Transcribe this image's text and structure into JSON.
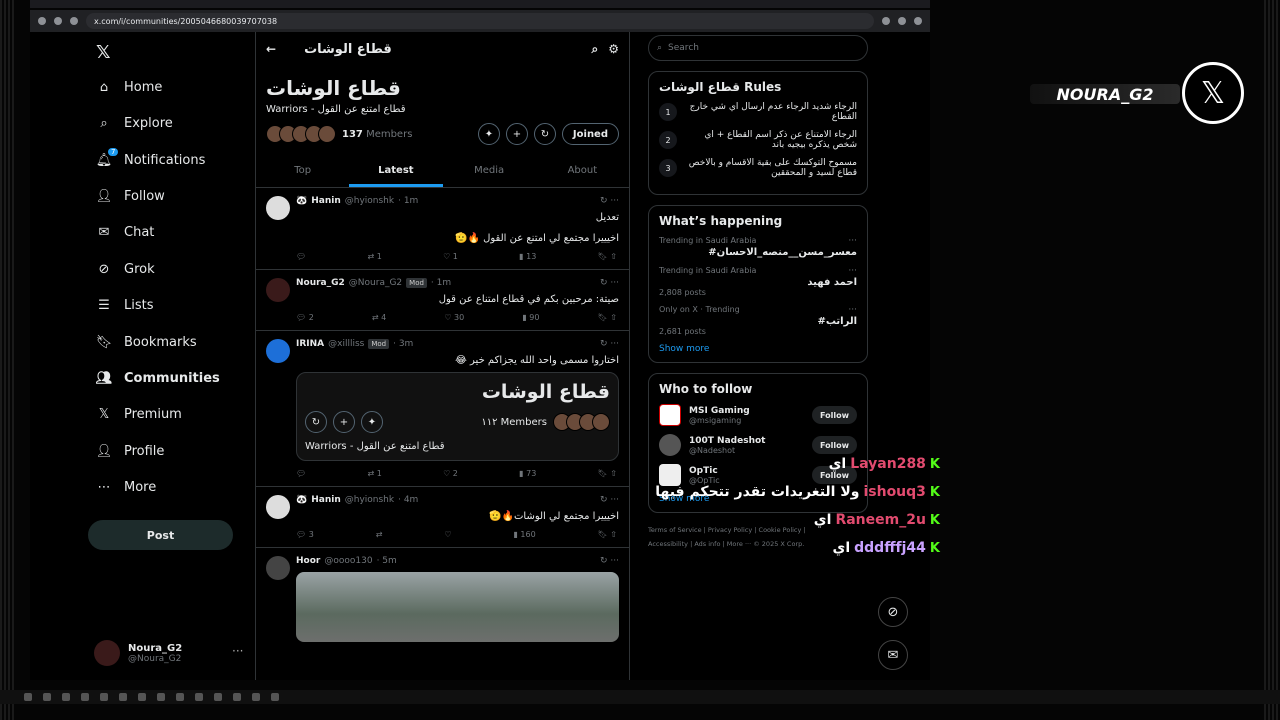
{
  "browser": {
    "url": "x.com/i/communities/2005046680039707038"
  },
  "nav": {
    "items": [
      {
        "label": "Home",
        "icon": "home-icon"
      },
      {
        "label": "Explore",
        "icon": "search-icon"
      },
      {
        "label": "Notifications",
        "icon": "bell-icon",
        "badge": "7"
      },
      {
        "label": "Follow",
        "icon": "follow-icon"
      },
      {
        "label": "Chat",
        "icon": "mail-icon"
      },
      {
        "label": "Grok",
        "icon": "grok-icon"
      },
      {
        "label": "Lists",
        "icon": "list-icon"
      },
      {
        "label": "Bookmarks",
        "icon": "bookmark-icon"
      },
      {
        "label": "Communities",
        "icon": "communities-icon"
      },
      {
        "label": "Premium",
        "icon": "x-icon"
      },
      {
        "label": "Profile",
        "icon": "person-icon"
      },
      {
        "label": "More",
        "icon": "more-icon"
      }
    ],
    "post_label": "Post",
    "user": {
      "name": "Noura_G2",
      "handle": "@Noura_G2"
    }
  },
  "community": {
    "topbar_title": "قطاع الوشات",
    "title": "قطاع الوشات",
    "subtitle": "Warriors - قطاع امتنع عن القول",
    "members_count": "137",
    "members_label": "Members",
    "joined_label": "Joined",
    "tabs": [
      "Top",
      "Latest",
      "Media",
      "About"
    ]
  },
  "tweets": [
    {
      "name": "Hanin",
      "emoji": "🐼",
      "handle": "@hyionshk",
      "time": "· 1m",
      "text1": "تعديل",
      "text2": "اخيييرا مجتمع لي امتنع عن القول 🔥🫡",
      "replies": "",
      "retweets": "1",
      "likes": "1",
      "views": "13"
    },
    {
      "name": "Noura_G2",
      "handle": "@Noura_G2",
      "mod": "Mod",
      "time": "· 1m",
      "text": "صيتة: مرحبين بكم في قطاع امتناع عن قول",
      "replies": "2",
      "retweets": "4",
      "likes": "30",
      "views": "90"
    },
    {
      "name": "IRINA",
      "handle": "@xillliss",
      "mod": "Mod",
      "time": "· 3m",
      "text": "اختاروا مسمى واحد الله يجزاكم خير 😂",
      "card_title": "قطاع الوشات",
      "card_members": "١١٢ Members",
      "card_sub": "Warriors - قطاع امتنع عن القول",
      "replies": "",
      "retweets": "1",
      "likes": "2",
      "views": "73"
    },
    {
      "name": "Hanin",
      "emoji": "🐼",
      "handle": "@hyionshk",
      "time": "· 4m",
      "text": "اخيييرا مجتمع لي الوشات🔥🫡",
      "replies": "3",
      "retweets": "",
      "likes": "",
      "views": "160"
    },
    {
      "name": "Hoor",
      "handle": "@oooo130",
      "time": "· 5m"
    }
  ],
  "sidebar": {
    "search_placeholder": "Search",
    "rules_title": "قطاع الوشات Rules",
    "rules": [
      {
        "n": "1",
        "text": "الرجاء شديد الرجاء عدم ارسال اي شي خارج القطاع"
      },
      {
        "n": "2",
        "text": "الرجاء الامتناع عن ذكر اسم القطاع + اي شخص يذكره بيجيه باند"
      },
      {
        "n": "3",
        "text": "مسموح التوكسك على بقية الاقسام و بالاخص قطاع لسيد و المحققين"
      }
    ],
    "happening_title": "What’s happening",
    "trends": [
      {
        "context": "Trending in Saudi Arabia",
        "title": "#معسر_مسن__منصه_الاحسان",
        "posts": ""
      },
      {
        "context": "Trending in Saudi Arabia",
        "title": "احمد فهيد",
        "posts": "2,808 posts"
      },
      {
        "context": "Only on X · Trending",
        "title": "#الراتب",
        "posts": "2,681 posts"
      }
    ],
    "show_more": "Show more",
    "wtf_title": "Who to follow",
    "wtf": [
      {
        "name": "MSI Gaming",
        "handle": "@msigaming",
        "btn": "Follow"
      },
      {
        "name": "100T Nadeshot",
        "handle": "@Nadeshot",
        "btn": "Follow"
      },
      {
        "name": "OpTic",
        "handle": "@OpTic",
        "btn": "Follow"
      }
    ],
    "footer": [
      "Terms of Service",
      "Privacy Policy",
      "Cookie Policy",
      "Accessibility",
      "Ads info",
      "More ···",
      "© 2025 X Corp."
    ]
  },
  "overlay": {
    "brand": "NOURA_G2",
    "chat": [
      {
        "user": "Layan288",
        "msg": "اي"
      },
      {
        "user": "ishouq3",
        "msg": "ولا التغريدات تقدر تتحكم فيها"
      },
      {
        "user": "Raneem_2u",
        "msg": "اي"
      },
      {
        "user": "dddfffj44",
        "msg": "اي"
      }
    ]
  },
  "colors": {
    "accent": "#1d9bf0",
    "kick": "#53fc18",
    "chat_user": "#e24b6f"
  }
}
